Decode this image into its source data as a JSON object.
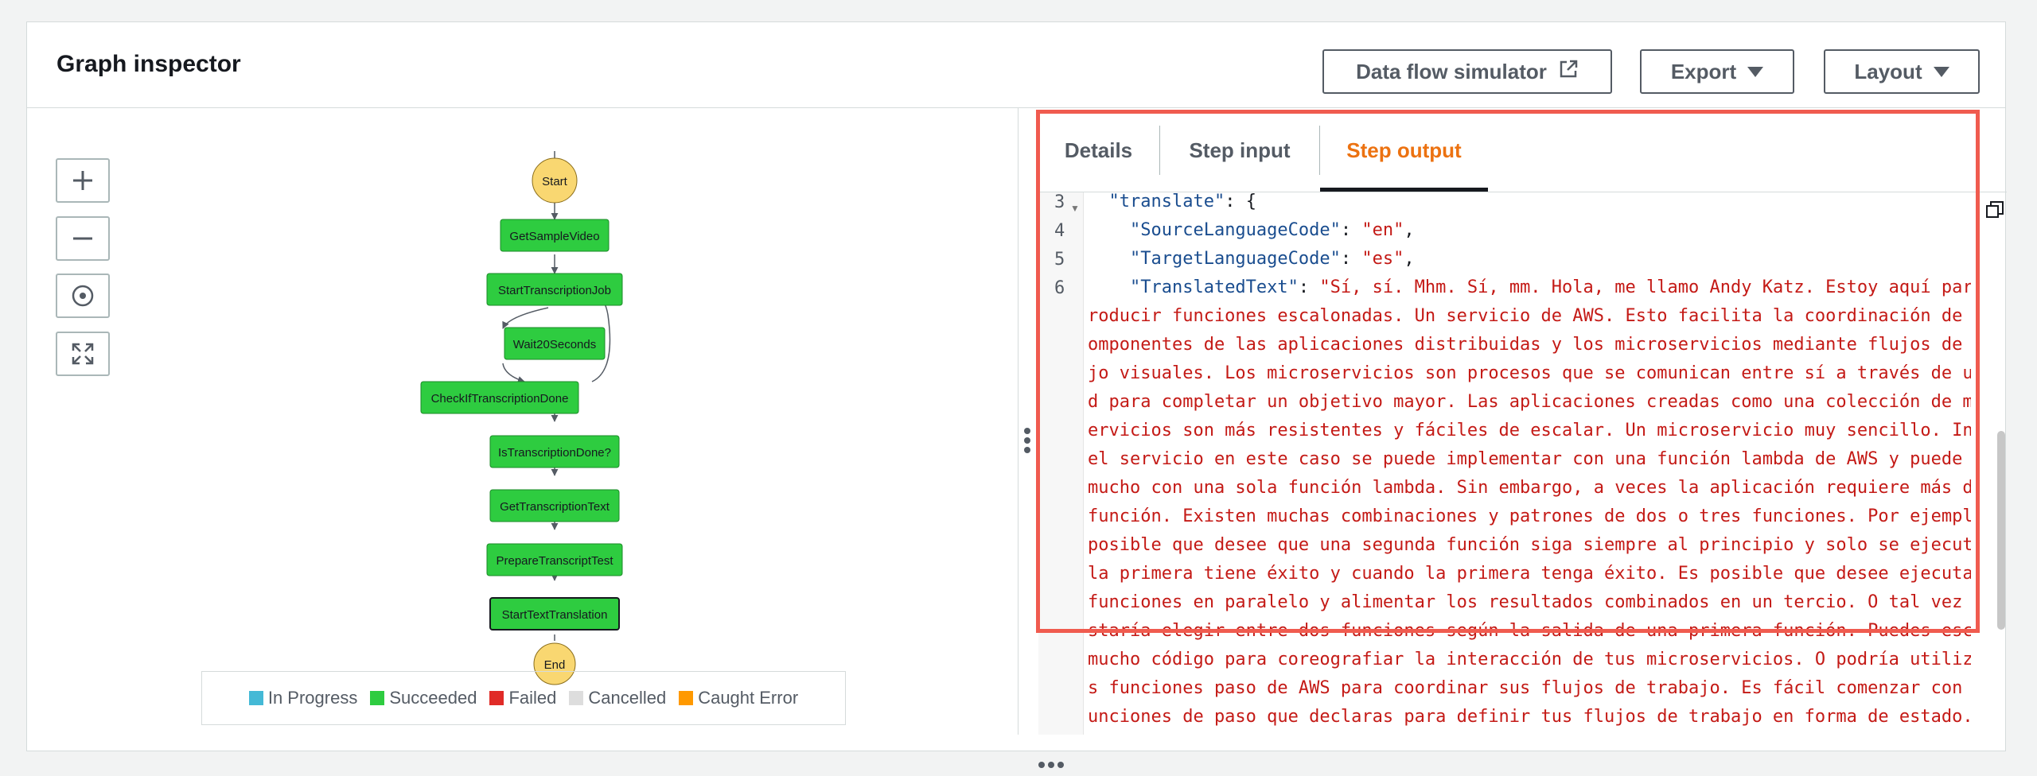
{
  "header": {
    "title": "Graph inspector",
    "buttons": [
      {
        "label": "Data flow simulator",
        "icon": "external-link-icon"
      },
      {
        "label": "Export",
        "icon": "caret-down-icon"
      },
      {
        "label": "Layout",
        "icon": "caret-down-icon"
      }
    ]
  },
  "graph": {
    "zoom_controls": [
      "zoom-in-icon",
      "zoom-out-icon",
      "center-icon",
      "fit-icon"
    ],
    "nodes": {
      "start": "Start",
      "end": "End",
      "steps": [
        "GetSampleVideo",
        "StartTranscriptionJob",
        "Wait20Seconds",
        "CheckIfTranscriptionDone",
        "IsTranscriptionDone?",
        "GetTranscriptionText",
        "PrepareTranscriptTest",
        "StartTextTranslation"
      ]
    },
    "legend": [
      {
        "label": "In Progress",
        "color": "#44b9d6"
      },
      {
        "label": "Succeeded",
        "color": "#2ecc40"
      },
      {
        "label": "Failed",
        "color": "#e02b27"
      },
      {
        "label": "Cancelled",
        "color": "#dddddd"
      },
      {
        "label": "Caught Error",
        "color": "#ff9900"
      }
    ]
  },
  "details": {
    "tabs": [
      "Details",
      "Step input",
      "Step output"
    ],
    "active_tab": "Step output",
    "code": {
      "line_numbers": [
        "3",
        "4",
        "5",
        "6"
      ],
      "line3_key": "\"translate\"",
      "line3_rest": ": {",
      "line4_key": "\"SourceLanguageCode\"",
      "line4_val": "\"en\"",
      "line5_key": "\"TargetLanguageCode\"",
      "line5_val": "\"es\"",
      "line6_key": "\"TranslatedText\"",
      "line6_val": "\"Sí, sí. Mhm. Sí, mm. Hola, me llamo Andy Katz. Estoy aquí para i",
      "wrapped": [
        "roducir funciones escalonadas. Un servicio de AWS. Esto facilita la coordinación de los",
        "omponentes de las aplicaciones distribuidas y los microservicios mediante flujos de tra",
        "jo visuales. Los microservicios son procesos que se comunican entre sí a través de una",
        "d para completar un objetivo mayor. Las aplicaciones creadas como una colección de mic",
        "ervicios son más resistentes y fáciles de escalar. Un microservicio muy sencillo. Incl",
        "el servicio en este caso se puede implementar con una función lambda de AWS y puede ha",
        "mucho con una sola función lambda. Sin embargo, a veces la aplicación requiere más de u",
        "función. Existen muchas combinaciones y patrones de dos o tres funciones. Por ejemplo,",
        "posible que desee que una segunda función siga siempre al principio y solo se ejecute s",
        "la primera tiene éxito y cuando la primera tenga éxito. Es posible que desee ejecutar d",
        "funciones en paralelo y alimentar los resultados combinados en un tercio. O tal vez te",
        "staría elegir entre dos funciones según la salida de una primera función. Puedes escri",
        "mucho código para coreografiar la interacción de tus microservicios. O podría utilizar",
        "s funciones paso de AWS para coordinar sus flujos de trabajo. Es fácil comenzar con las",
        "unciones de paso que declaras para definir tus flujos de trabajo en forma de estado. La"
      ]
    }
  }
}
